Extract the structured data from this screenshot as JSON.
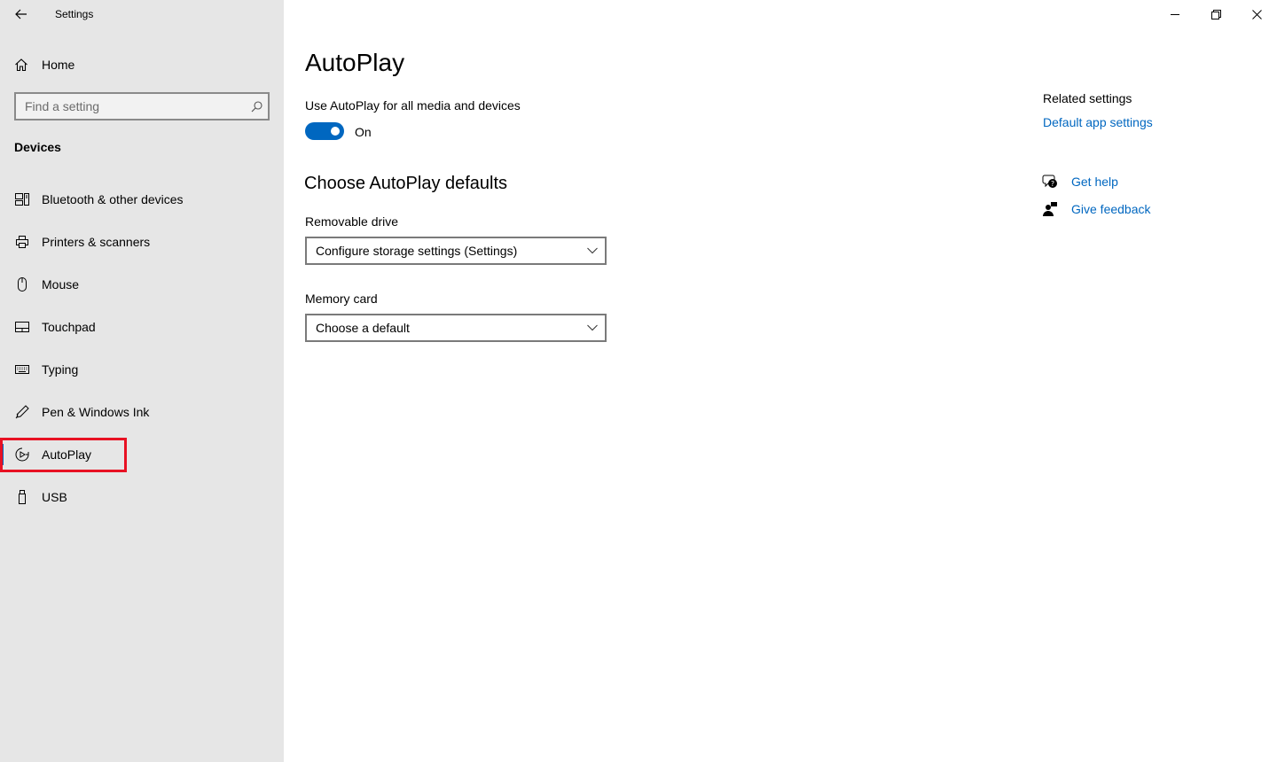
{
  "window": {
    "title": "Settings",
    "controls": [
      "minimize-icon",
      "restore-icon",
      "close-icon"
    ]
  },
  "sidebar": {
    "home_label": "Home",
    "search_placeholder": "Find a setting",
    "section_heading": "Devices",
    "items": [
      {
        "label": "Bluetooth & other devices",
        "icon": "bluetooth-devices-icon"
      },
      {
        "label": "Printers & scanners",
        "icon": "printer-icon"
      },
      {
        "label": "Mouse",
        "icon": "mouse-icon"
      },
      {
        "label": "Touchpad",
        "icon": "touchpad-icon"
      },
      {
        "label": "Typing",
        "icon": "keyboard-icon"
      },
      {
        "label": "Pen & Windows Ink",
        "icon": "pen-icon"
      },
      {
        "label": "AutoPlay",
        "icon": "autoplay-icon",
        "selected": true
      },
      {
        "label": "USB",
        "icon": "usb-icon"
      }
    ]
  },
  "main": {
    "title": "AutoPlay",
    "toggle_label": "Use AutoPlay for all media and devices",
    "toggle_state": "On",
    "toggle_on": true,
    "defaults_heading": "Choose AutoPlay defaults",
    "removable_drive": {
      "label": "Removable drive",
      "value": "Configure storage settings (Settings)"
    },
    "memory_card": {
      "label": "Memory card",
      "value": "Choose a default"
    }
  },
  "related": {
    "title": "Related settings",
    "default_app_link": "Default app settings",
    "get_help": "Get help",
    "give_feedback": "Give feedback"
  },
  "colors": {
    "accent": "#0067c0",
    "sidebar_bg": "#e6e6e6",
    "highlight": "#e81123"
  }
}
